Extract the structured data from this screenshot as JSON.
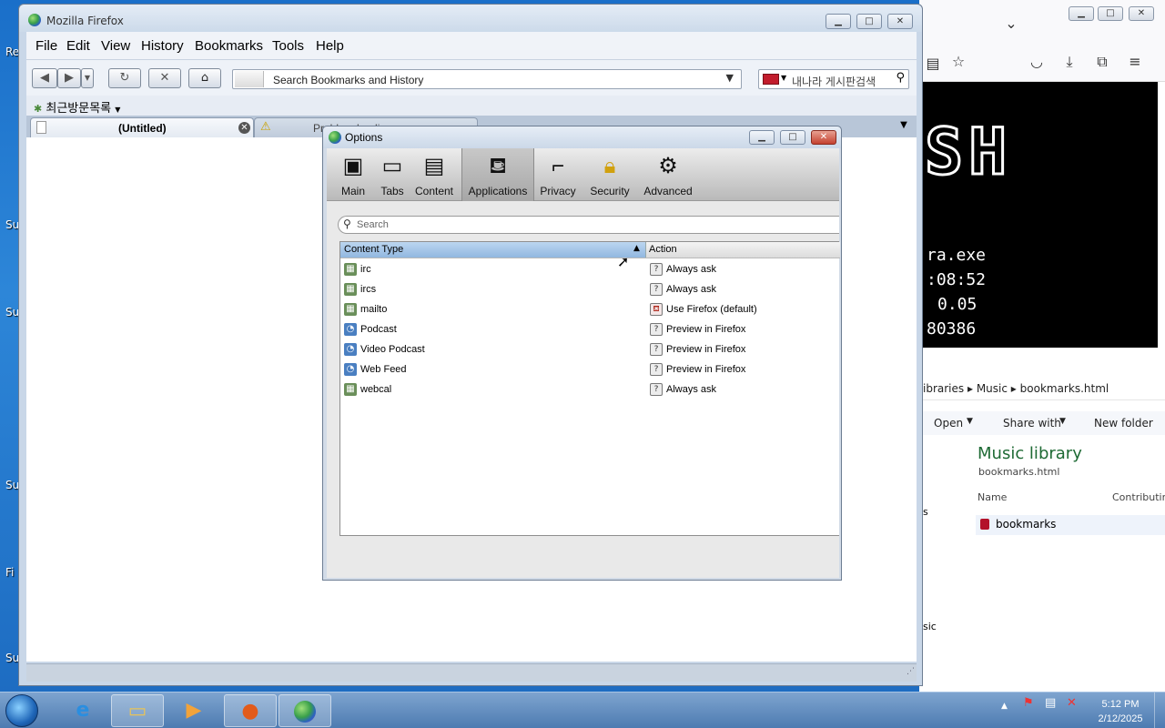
{
  "desktop": {
    "labels": [
      "Re",
      "Su",
      "Su",
      "Su",
      "Fi",
      "Su"
    ]
  },
  "background_window": {
    "terminal": {
      "big_text": "SH",
      "lines": [
        "ra.exe",
        ":08:52",
        "0.05",
        "80386"
      ]
    },
    "explorer": {
      "breadcrumb": [
        "ibraries",
        "Music",
        "bookmarks.html"
      ],
      "open_label": "Open",
      "share_label": "Share with",
      "new_folder_label": "New folder",
      "library_title": "Music library",
      "library_subtitle": "bookmarks.html",
      "col_name": "Name",
      "col_contrib": "Contributin",
      "file_name": "bookmarks",
      "side_text_1": "s",
      "side_text_2": "sic"
    }
  },
  "firefox": {
    "title": "Mozilla Firefox",
    "menu": [
      "File",
      "Edit",
      "View",
      "History",
      "Bookmarks",
      "Tools",
      "Help"
    ],
    "url_placeholder": "Search Bookmarks and History",
    "search_text": "내나라 게시판검색",
    "bookmarks_item": "최근방문목록",
    "tabs": [
      {
        "label": "(Untitled)"
      },
      {
        "label": "Problem loading page"
      }
    ]
  },
  "options_dialog": {
    "title": "Options",
    "panes": [
      {
        "label": "Main",
        "icon": "main-icon"
      },
      {
        "label": "Tabs",
        "icon": "tabs-icon"
      },
      {
        "label": "Content",
        "icon": "content-icon"
      },
      {
        "label": "Applications",
        "icon": "applications-icon",
        "selected": true
      },
      {
        "label": "Privacy",
        "icon": "privacy-icon"
      },
      {
        "label": "Security",
        "icon": "security-icon"
      },
      {
        "label": "Advanced",
        "icon": "advanced-icon"
      }
    ],
    "search_placeholder": "Search",
    "columns": {
      "content_type": "Content Type",
      "action": "Action"
    },
    "rows": [
      {
        "type": "irc",
        "action": "Always ask",
        "type_icon": "webcal-icon"
      },
      {
        "type": "ircs",
        "action": "Always ask",
        "type_icon": "webcal-icon"
      },
      {
        "type": "mailto",
        "action": "Use Firefox (default)",
        "type_icon": "webcal-icon"
      },
      {
        "type": "Podcast",
        "action": "Preview in Firefox",
        "type_icon": "feed-icon"
      },
      {
        "type": "Video Podcast",
        "action": "Preview in Firefox",
        "type_icon": "feed-icon"
      },
      {
        "type": "Web Feed",
        "action": "Preview in Firefox",
        "type_icon": "feed-icon"
      },
      {
        "type": "webcal",
        "action": "Always ask",
        "type_icon": "webcal-icon"
      }
    ]
  },
  "taskbar": {
    "time": "5:12 PM",
    "date": "2/12/2025"
  },
  "colors": {
    "selected_header": "#91b7e0",
    "close_button": "#c4412f",
    "desktop": "#1a6fc9"
  }
}
